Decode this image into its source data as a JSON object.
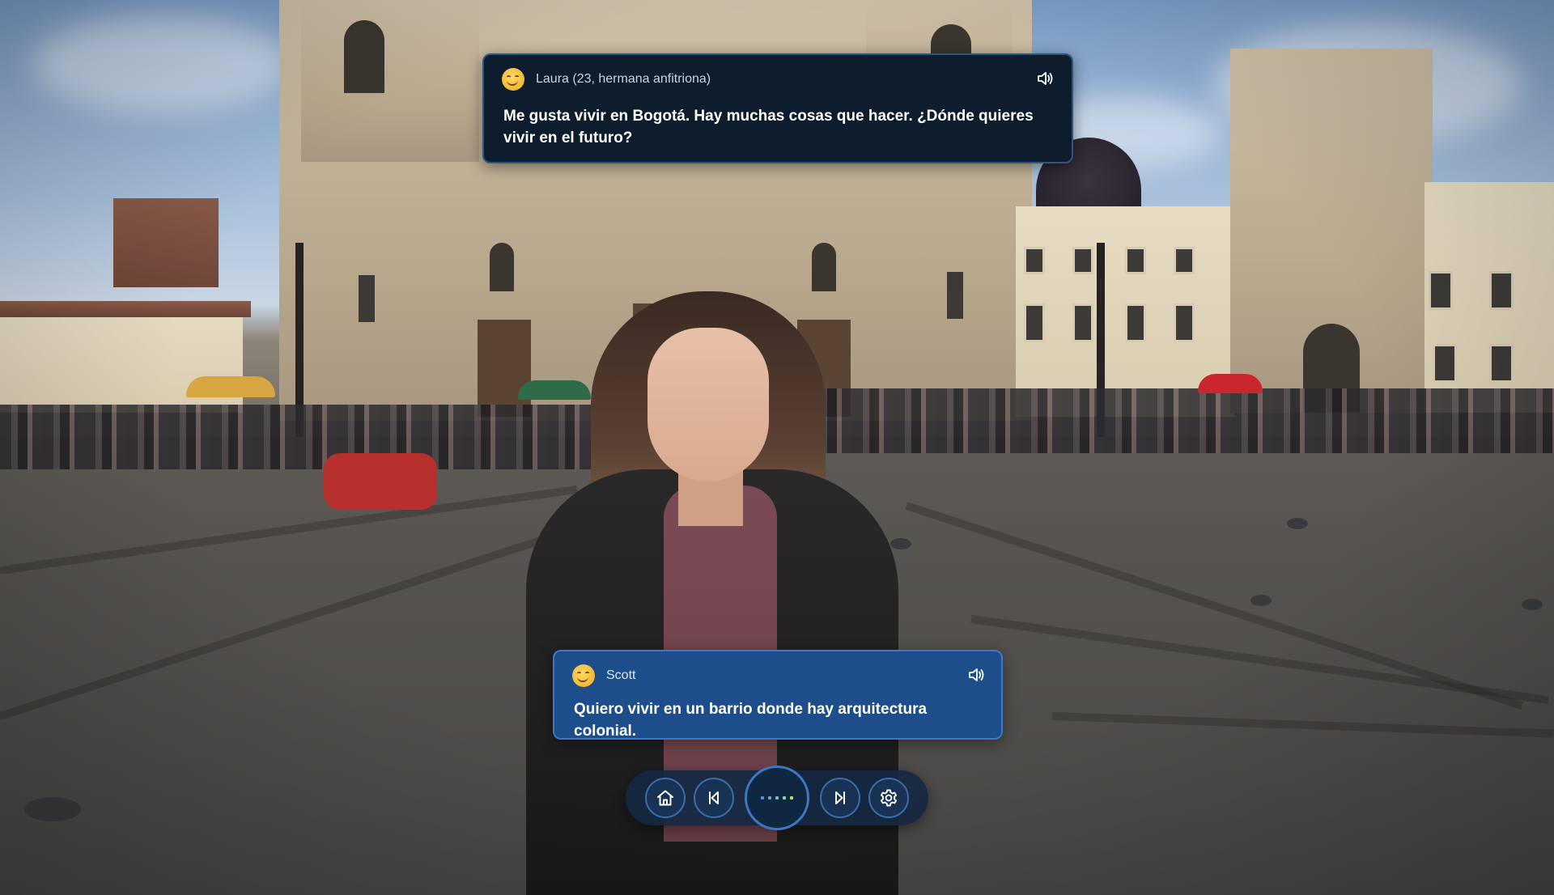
{
  "scene": {
    "description_icon": "plaza-video-background"
  },
  "dialogue": {
    "host": {
      "speaker": "Laura (23, hermana anfitriona)",
      "text": "Me gusta vivir en Bogotá. Hay muchas cosas que hacer. ¿Dónde quieres vivir en el futuro?",
      "avatar_icon": "smiley-face-icon",
      "audio_icon": "speaker-icon"
    },
    "user": {
      "speaker": "Scott",
      "text": "Quiero vivir en un barrio donde hay arquitectura colonial.",
      "avatar_icon": "smiley-face-icon",
      "audio_icon": "speaker-icon"
    }
  },
  "controls": {
    "home_icon": "home-icon",
    "previous_icon": "skip-back-icon",
    "record_icon": "audio-dots-icon",
    "next_icon": "skip-forward-icon",
    "settings_icon": "gear-icon"
  },
  "colors": {
    "host_card_bg": "#0e1d2e",
    "user_card_bg": "#1d4d8b",
    "control_bar_bg": "#142842",
    "accent_blue": "#3d79c2",
    "dot_colors": [
      "#4f8fd6",
      "#5aa6d4",
      "#6cc0c0",
      "#86d39a",
      "#b6e06a"
    ]
  }
}
